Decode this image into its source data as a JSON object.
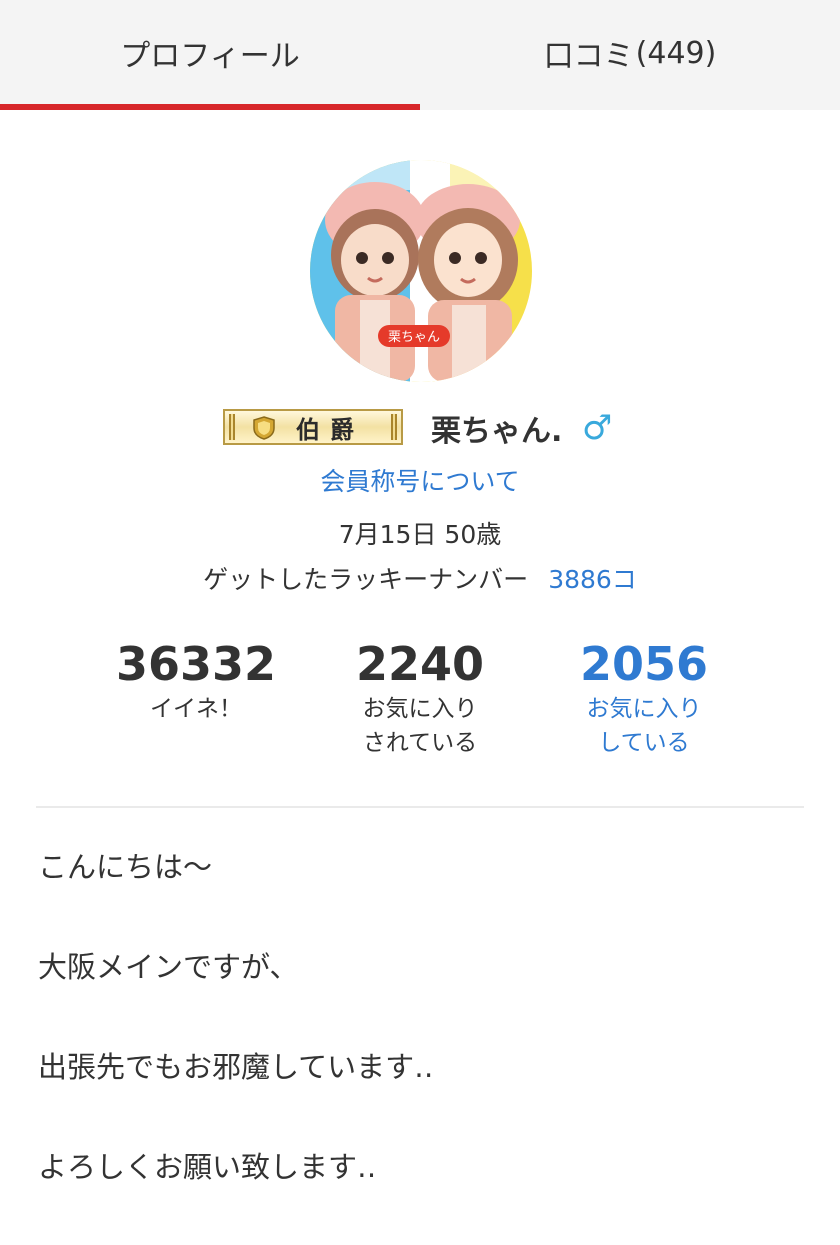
{
  "tabs": [
    {
      "label": "プロフィール",
      "active": true
    },
    {
      "label": "口コミ",
      "count": "(449)",
      "active": false
    }
  ],
  "profile": {
    "avatar_tag": "栗ちゃん",
    "rank_label": "伯爵",
    "username": "栗ちゃん.",
    "gender_symbol": "♂",
    "title_link": "会員称号について",
    "birthday_age": "7月15日 50歳",
    "lucky_label": "ゲットしたラッキーナンバー",
    "lucky_value": "3886コ"
  },
  "stats": {
    "likes": {
      "value": "36332",
      "label": "イイネ！"
    },
    "followers": {
      "value": "2240",
      "label": "お気に入り\nされている"
    },
    "following": {
      "value": "2056",
      "label": "お気に入り\nしている"
    }
  },
  "bio": [
    "こんにちは〜",
    "大阪メインですが、",
    "出張先でもお邪魔しています‥",
    "よろしくお願い致します‥"
  ],
  "colors": {
    "accent_red": "#d7262a",
    "link_blue": "#2f7ad1",
    "gender_blue": "#39a9dc"
  }
}
